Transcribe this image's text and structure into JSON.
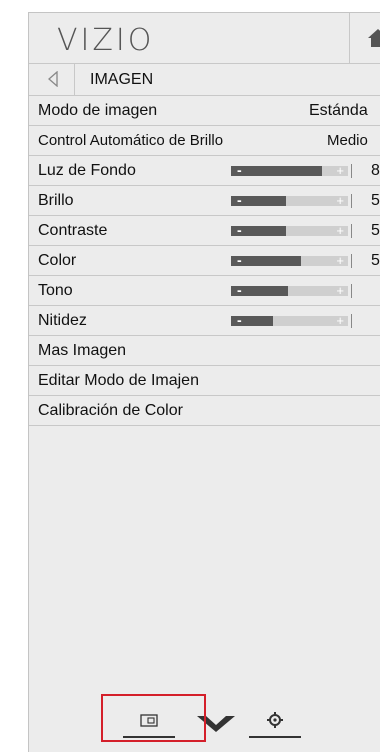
{
  "header": {
    "logo": "VIZIO",
    "home_icon": "home-icon"
  },
  "subheader": {
    "back_icon": "back-arrow-icon",
    "title": "IMAGEN"
  },
  "menu": {
    "modo": {
      "label": "Modo de imagen",
      "value": "Estánda"
    },
    "control": {
      "label": "Control Automático de Brillo",
      "value": "Medio"
    },
    "luz": {
      "label": "Luz de Fondo",
      "value": "8",
      "level": 0.78
    },
    "brillo": {
      "label": "Brillo",
      "value": "5",
      "level": 0.47
    },
    "contraste": {
      "label": "Contraste",
      "value": "5",
      "level": 0.47
    },
    "color": {
      "label": "Color",
      "value": "5",
      "level": 0.6
    },
    "tono": {
      "label": "Tono",
      "value": "",
      "level": 0.49
    },
    "nitidez": {
      "label": "Nitidez",
      "value": "",
      "level": 0.36
    },
    "mas": {
      "label": "Mas Imagen"
    },
    "editar": {
      "label": "Editar Modo de Imajen"
    },
    "calibracion": {
      "label": "Calibración de Color"
    }
  },
  "slider_glyphs": {
    "minus": "-",
    "plus": "+"
  },
  "bottom_bar": {
    "icons": [
      "picture-icon",
      "vizio-v-icon",
      "gear-icon"
    ],
    "highlight_color": "#d41f2a"
  }
}
